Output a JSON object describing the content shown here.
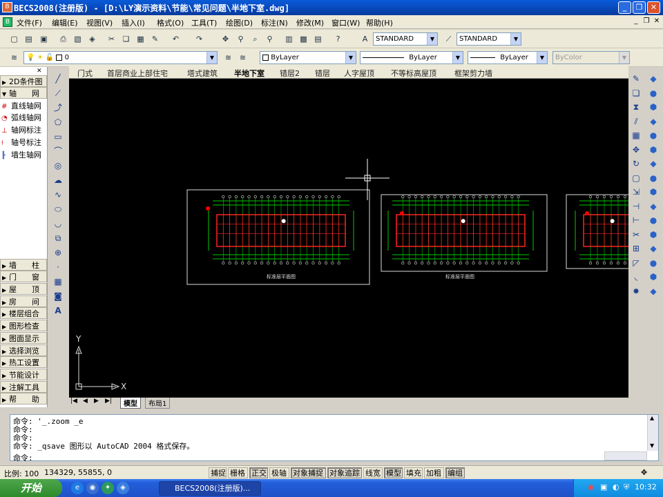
{
  "titlebar": {
    "title": "BECS2008(注册版) - [D:\\LY演示资料\\节能\\常见问题\\半地下室.dwg]",
    "icon": "becs-app-icon"
  },
  "menu": [
    "文件(F)",
    "编辑(E)",
    "视图(V)",
    "插入(I)",
    "格式(O)",
    "工具(T)",
    "绘图(D)",
    "标注(N)",
    "修改(M)",
    "窗口(W)",
    "帮助(H)"
  ],
  "styles": {
    "text_style": "STANDARD",
    "dim_style": "STANDARD"
  },
  "layers": {
    "current": "0"
  },
  "properties": {
    "color": "ByLayer",
    "linetype": "ByLayer",
    "lineweight": "ByLayer",
    "plotstyle": "ByColor"
  },
  "left_panel": {
    "top_items": [
      {
        "label": "2D条件图",
        "type": "header"
      },
      {
        "label": "轴　　网",
        "type": "header_open"
      },
      {
        "label": "直线轴网",
        "type": "sub",
        "icon": "grid-icon"
      },
      {
        "label": "弧线轴网",
        "type": "sub",
        "icon": "arc-grid-icon"
      },
      {
        "label": "轴网标注",
        "type": "sub",
        "icon": "axis-dim-icon"
      },
      {
        "label": "轴号标注",
        "type": "sub",
        "icon": "axis-number-icon"
      },
      {
        "label": "墙生轴网",
        "type": "sub",
        "icon": "wall-grid-icon"
      }
    ],
    "bottom_items": [
      "墙　　柱",
      "门　　窗",
      "屋　　顶",
      "房　　间",
      "楼层组合",
      "图形检查",
      "图面显示",
      "选择浏览",
      "热工设置",
      "节能设计",
      "注解工具",
      "帮　　助"
    ]
  },
  "file_tabs": [
    "门式",
    "首层商业上部住宅",
    "塔式建筑",
    "半地下室",
    "错层2",
    "错层",
    "人字屋顶",
    "不等标高屋顶",
    "框架剪力墙"
  ],
  "active_tab": "半地下室",
  "drawing": {
    "plan_labels": [
      "标准层平面图",
      "标准层平面图"
    ],
    "ucs_x": "X",
    "ucs_y": "Y"
  },
  "layout_tabs": {
    "model": "模型",
    "layout1": "布局1"
  },
  "command_history": [
    "命令: '_.zoom _e",
    "命令:",
    "命令:",
    "命令: _qsave 图形以 AutoCAD 2004 格式保存。",
    "命令:"
  ],
  "status": {
    "scale_label": "比例: 100",
    "coords": "134329, 55855, 0",
    "toggles": [
      {
        "label": "捕捉",
        "on": false
      },
      {
        "label": "栅格",
        "on": false
      },
      {
        "label": "正交",
        "on": true
      },
      {
        "label": "极轴",
        "on": false
      },
      {
        "label": "对象捕捉",
        "on": true
      },
      {
        "label": "对象追踪",
        "on": true
      },
      {
        "label": "线宽",
        "on": false
      },
      {
        "label": "模型",
        "on": true
      },
      {
        "label": "填充",
        "on": false
      },
      {
        "label": "加粗",
        "on": false
      },
      {
        "label": "编组",
        "on": true
      }
    ]
  },
  "taskbar": {
    "start": "开始",
    "task": "BECS2008(注册版)...",
    "clock": "10:32"
  }
}
